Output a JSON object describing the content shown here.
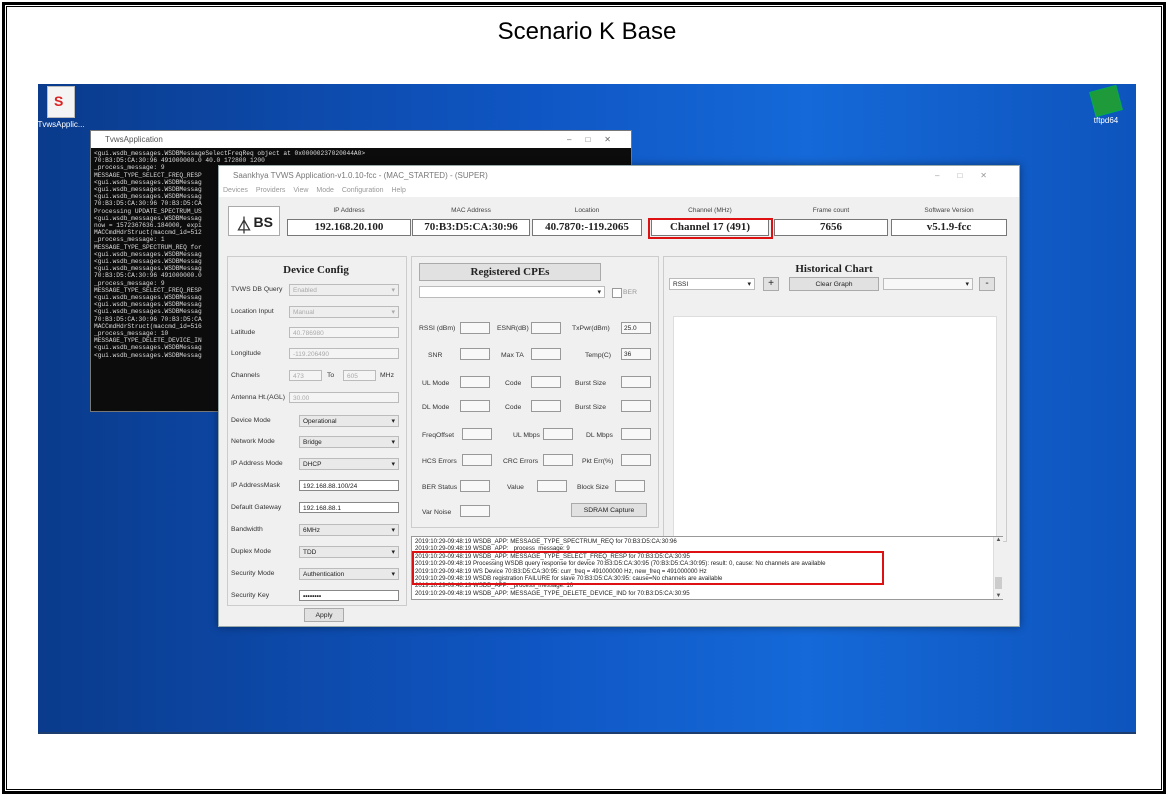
{
  "slide": {
    "title": "Scenario K Base"
  },
  "desktop_icons": [
    {
      "label": "TvwsApplic...",
      "icon": "tvws-app-icon"
    },
    {
      "label": "tftpd64",
      "icon": "tftpd64-icon"
    }
  ],
  "console": {
    "title": "TvwsApplication",
    "lines": [
      "<gui.wsdb_messages.WSDBMessageSelectFreqReq object at 0x00000237020044A0>",
      "70:B3:D5:CA:30:96 491000000.0 40.0 172800 1200",
      "_process_message: 9",
      "MESSAGE_TYPE_SELECT_FREQ_RESP",
      "<gui.wsdb_messages.WSDBMessag",
      "<gui.wsdb_messages.WSDBMessag",
      "<gui.wsdb_messages.WSDBMessag",
      "70:B3:D5:CA:30:96 70:B3:D5:CA",
      "Processing UPDATE_SPECTRUM_US",
      "<gui.wsdb_messages.WSDBMessag",
      "now = 1572367636.184000, expi",
      "MACCmdHdrStruct(maccmd_id=512",
      "_process_message: 1",
      "MESSAGE_TYPE_SPECTRUM_REQ for",
      "<gui.wsdb_messages.WSDBMessag",
      "<gui.wsdb_messages.WSDBMessag",
      "<gui.wsdb_messages.WSDBMessag",
      "70:B3:D5:CA:30:96 491000000.0",
      "_process_message: 9",
      "MESSAGE_TYPE_SELECT_FREQ_RESP",
      "<gui.wsdb_messages.WSDBMessag",
      "<gui.wsdb_messages.WSDBMessag",
      "<gui.wsdb_messages.WSDBMessag",
      "70:B3:D5:CA:30:96 70:B3:D5:CA",
      "MACCmdHdrStruct(maccmd_id=516",
      "_process_message: 10",
      "MESSAGE_TYPE_DELETE_DEVICE_IN",
      "<gui.wsdb_messages.WSDBMessag",
      "<gui.wsdb_messages.WSDBMessag"
    ]
  },
  "app": {
    "title": "Saankhya TVWS Application-v1.0.10-fcc - (MAC_STARTED) - (SUPER)",
    "menu": [
      "Devices",
      "Providers",
      "View",
      "Mode",
      "Configuration",
      "Help"
    ],
    "logo": "BS",
    "header": [
      {
        "label": "IP Address",
        "value": "192.168.20.100"
      },
      {
        "label": "MAC Address",
        "value": "70:B3:D5:CA:30:96"
      },
      {
        "label": "Location",
        "value": "40.7870:-119.2065"
      },
      {
        "label": "Channel (MHz)",
        "value": "Channel 17 (491)"
      },
      {
        "label": "Frame count",
        "value": "7656"
      },
      {
        "label": "Software Version",
        "value": "v5.1.9-fcc"
      }
    ],
    "device_config": {
      "title": "Device Config",
      "tvws_db_query": {
        "label": "TVWS DB Query",
        "value": "Enabled"
      },
      "location_input": {
        "label": "Location Input",
        "value": "Manual"
      },
      "latitude": {
        "label": "Latitude",
        "value": "40.786980"
      },
      "longitude": {
        "label": "Longitude",
        "value": "-119.206490"
      },
      "channels": {
        "label": "Channels",
        "from": "473",
        "to_label": "To",
        "to": "605",
        "unit": "MHz"
      },
      "antenna": {
        "label": "Antenna Ht.(AGL)",
        "value": "30.00"
      },
      "device_mode": {
        "label": "Device Mode",
        "value": "Operational"
      },
      "network_mode": {
        "label": "Network Mode",
        "value": "Bridge"
      },
      "ip_mode": {
        "label": "IP Address Mode",
        "value": "DHCP"
      },
      "ip_mask": {
        "label": "IP AddressMask",
        "value": "192.168.88.100/24"
      },
      "gateway": {
        "label": "Default Gateway",
        "value": "192.168.88.1"
      },
      "bandwidth": {
        "label": "Bandwidth",
        "value": "6MHz"
      },
      "duplex": {
        "label": "Duplex Mode",
        "value": "TDD"
      },
      "security_mode": {
        "label": "Security Mode",
        "value": "Authentication"
      },
      "security_key": {
        "label": "Security Key",
        "value": "••••••••"
      },
      "apply": "Apply"
    },
    "cpes": {
      "title": "Registered CPEs",
      "ber": "BER",
      "rssi": "RSSI (dBm)",
      "esnr": "ESNR(dB)",
      "txpwr": "TxPwr(dBm)",
      "txpwr_value": "25.0",
      "snr": "SNR",
      "max_ta": "Max TA",
      "temp": "Temp(C)",
      "temp_value": "36",
      "ul_mode": "UL Mode",
      "code1": "Code",
      "burst1": "Burst Size",
      "dl_mode": "DL Mode",
      "code2": "Code",
      "burst2": "Burst Size",
      "freq_offset": "FreqOffset",
      "ul_mbps": "UL Mbps",
      "dl_mbps": "DL Mbps",
      "hcs": "HCS Errors",
      "crc": "CRC Errors",
      "pkt": "Pkt Err(%)",
      "ber_status": "BER Status",
      "value": "Value",
      "block": "Block Size",
      "var_noise": "Var Noise",
      "sdram": "SDRAM Capture"
    },
    "chart": {
      "title": "Historical Chart",
      "metric": "RSSI",
      "add": "+",
      "clear": "Clear Graph",
      "remove": "-"
    },
    "log": [
      "2019:10:29-09:48:19 WSDB_APP: MESSAGE_TYPE_SPECTRUM_REQ for 70:B3:D5:CA:30:96",
      "2019:10:29-09:48:19 WSDB_APP: _process_message: 9",
      "2019:10:29-09:48:19 WSDB_APP: MESSAGE_TYPE_SELECT_FREQ_RESP for 70:B3:D5:CA:30:95",
      "2019:10:29-09:48:19 Processing WSDB query response for device 70:B3:D5:CA:30:95 (70:B3:D5:CA:30:95): result: 0, cause: No channels are available",
      "2019:10:29-09:48:19 WS Device 70:B3:D5:CA:30:95: curr_freq = 491000000 Hz, new_freq = 491000000 Hz",
      "2019:10:29-09:48:19 WSDB registration FAILURE for slave 70:B3:D5:CA:30:95: cause=No channels are available",
      "2019:10:29-09:48:19 WSDB_APP: _process_message: 10",
      "2019:10:29-09:48:19 WSDB_APP: MESSAGE_TYPE_DELETE_DEVICE_IND for  70:B3:D5:CA:30:95"
    ]
  }
}
